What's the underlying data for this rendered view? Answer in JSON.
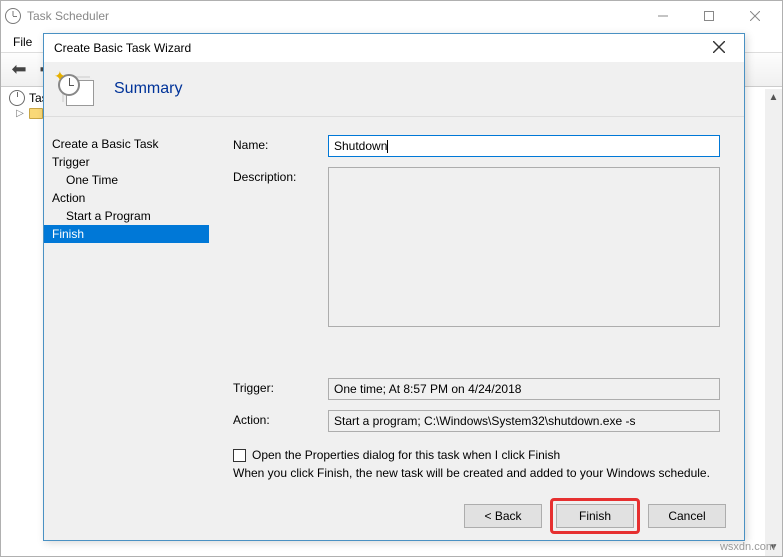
{
  "window": {
    "title": "Task Scheduler",
    "menu": {
      "file": "File"
    }
  },
  "tree": {
    "root": "Tas",
    "child": ""
  },
  "dialog": {
    "title": "Create Basic Task Wizard",
    "header": "Summary",
    "sidebar": {
      "items": [
        {
          "label": "Create a Basic Task",
          "sub": false
        },
        {
          "label": "Trigger",
          "sub": false
        },
        {
          "label": "One Time",
          "sub": true
        },
        {
          "label": "Action",
          "sub": false
        },
        {
          "label": "Start a Program",
          "sub": true
        },
        {
          "label": "Finish",
          "sub": false,
          "selected": true
        }
      ]
    },
    "form": {
      "name_label": "Name:",
      "name_value": "Shutdown",
      "description_label": "Description:",
      "description_value": "",
      "trigger_label": "Trigger:",
      "trigger_value": "One time; At 8:57 PM on 4/24/2018",
      "action_label": "Action:",
      "action_value": "Start a program; C:\\Windows\\System32\\shutdown.exe -s",
      "checkbox_label": "Open the Properties dialog for this task when I click Finish",
      "hint": "When you click Finish, the new task will be created and added to your Windows schedule."
    },
    "buttons": {
      "back": "< Back",
      "finish": "Finish",
      "cancel": "Cancel"
    }
  },
  "watermark": "wsxdn.com"
}
